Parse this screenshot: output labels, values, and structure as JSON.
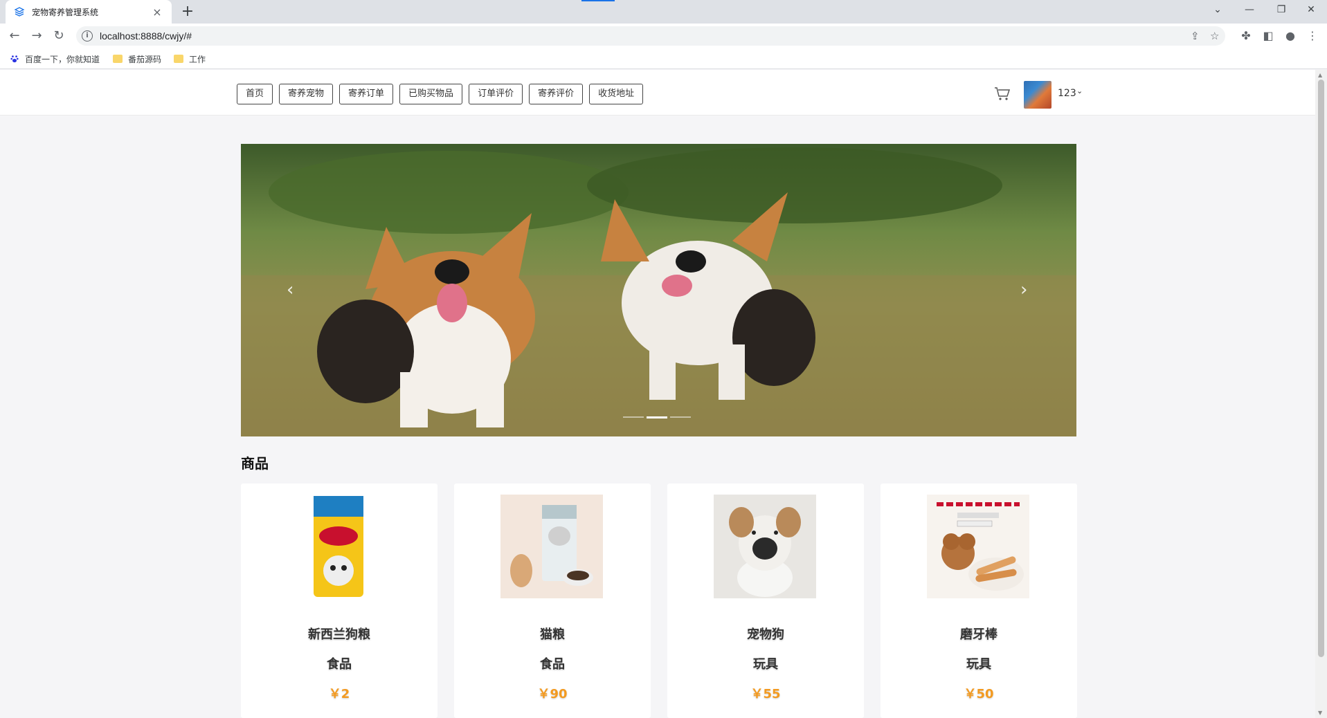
{
  "browser": {
    "tab_title": "宠物寄养管理系统",
    "url": "localhost:8888/cwjy/#",
    "bookmarks": [
      {
        "label": "百度一下，你就知道",
        "icon": "baidu-icon"
      },
      {
        "label": "番茄源码",
        "icon": "folder-icon"
      },
      {
        "label": "工作",
        "icon": "folder-icon"
      }
    ]
  },
  "header": {
    "menu": [
      "首页",
      "寄养宠物",
      "寄养订单",
      "已购买物品",
      "订单评价",
      "寄养评价",
      "收货地址"
    ],
    "username": "123",
    "cart_icon": "cart-icon"
  },
  "carousel": {
    "slide_count": 3,
    "active_slide": 2
  },
  "section_title": "商品",
  "products": [
    {
      "name": "新西兰狗粮",
      "category": "食品",
      "price": "￥2"
    },
    {
      "name": "猫粮",
      "category": "食品",
      "price": "￥90"
    },
    {
      "name": "宠物狗",
      "category": "玩具",
      "price": "￥55"
    },
    {
      "name": "磨牙棒",
      "category": "玩具",
      "price": "￥50"
    }
  ],
  "colors": {
    "price": "#f39a20",
    "accent_tab": "#1a73e8"
  }
}
